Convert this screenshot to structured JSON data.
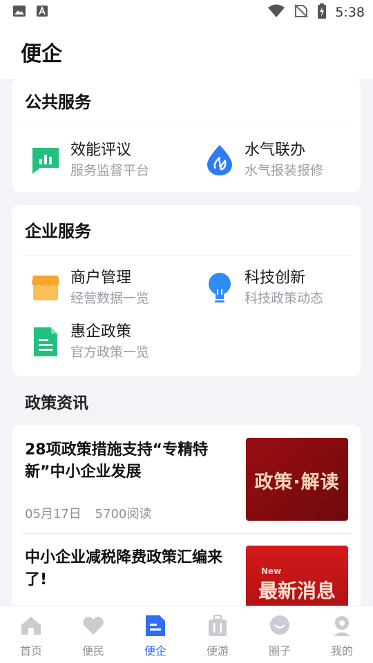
{
  "status_bar": {
    "time": "5:38",
    "icons": [
      "image-icon",
      "font-icon",
      "wifi-icon",
      "no-signal-icon",
      "battery-charging-icon"
    ]
  },
  "header": {
    "title": "便企"
  },
  "public_services": {
    "title": "公共服务",
    "items": [
      {
        "name": "效能评议",
        "sub": "服务监督平台",
        "icon": "chart-bubble-icon",
        "color": "#22c07e"
      },
      {
        "name": "水气联办",
        "sub": "水气报装报修",
        "icon": "water-drop-icon",
        "color": "#2f7bf6"
      }
    ]
  },
  "enterprise_services": {
    "title": "企业服务",
    "items": [
      {
        "name": "商户管理",
        "sub": "经营数据一览",
        "icon": "shop-icon",
        "color": "#f6a531"
      },
      {
        "name": "科技创新",
        "sub": "科技政策动态",
        "icon": "lightbulb-icon",
        "color": "#2f7bf6"
      },
      {
        "name": "惠企政策",
        "sub": "官方政策一览",
        "icon": "document-icon",
        "color": "#22c07e"
      }
    ]
  },
  "news": {
    "title": "政策资讯",
    "items": [
      {
        "title": "28项政策措施支持“专精特新”中小企业发展",
        "date": "05月17日",
        "reads": "5700阅读",
        "thumb_text": "政策·解读"
      },
      {
        "title": "中小企业减税降费政策汇编来了!",
        "thumb_badge": "New",
        "thumb_text": "最新消息"
      }
    ]
  },
  "tabs": [
    {
      "label": "首页",
      "icon": "home-icon",
      "active": false
    },
    {
      "label": "便民",
      "icon": "heart-icon",
      "active": false
    },
    {
      "label": "便企",
      "icon": "enterprise-doc-icon",
      "active": true
    },
    {
      "label": "便游",
      "icon": "luggage-icon",
      "active": false
    },
    {
      "label": "圈子",
      "icon": "chat-bubble-icon",
      "active": false
    },
    {
      "label": "我的",
      "icon": "profile-icon",
      "active": false
    }
  ],
  "colors": {
    "accent": "#2f6ef6",
    "tab_inactive": "#c9ccd2",
    "background": "#f2f4f7"
  }
}
